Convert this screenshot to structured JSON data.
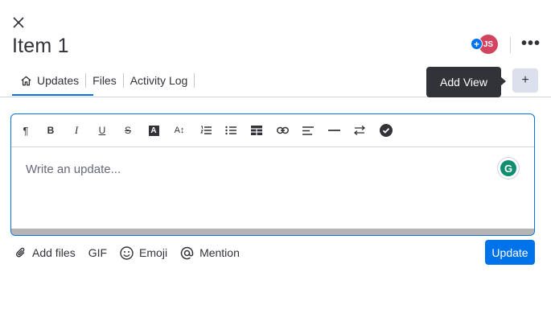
{
  "header": {
    "title": "Item 1",
    "avatar_initials": "JS",
    "add_badge_symbol": "+",
    "more_symbol": "•••"
  },
  "tabs": [
    {
      "label": "Updates",
      "icon": "home-icon",
      "active": true
    },
    {
      "label": "Files",
      "active": false
    },
    {
      "label": "Activity Log",
      "active": false
    }
  ],
  "tooltip": {
    "text": "Add View"
  },
  "add_view_button": {
    "symbol": "+"
  },
  "editor": {
    "placeholder": "Write an update...",
    "toolbar_icons": [
      "paragraph-icon",
      "bold-icon",
      "italic-icon",
      "underline-icon",
      "strikethrough-icon",
      "text-color-icon",
      "font-size-icon",
      "numbered-list-icon",
      "bullet-list-icon",
      "table-icon",
      "link-icon",
      "align-icon",
      "divider-icon",
      "direction-icon",
      "checklist-icon"
    ],
    "toolbar_glyphs": {
      "paragraph": "¶",
      "bold": "B",
      "italic": "I",
      "underline": "U",
      "strike": "S",
      "text_color": "A",
      "font_size": "A↕"
    },
    "grammarly_letter": "G"
  },
  "actions": [
    {
      "label": "Add files",
      "icon": "paperclip-icon"
    },
    {
      "label": "GIF"
    },
    {
      "label": "Emoji",
      "icon": "smiley-icon"
    },
    {
      "label": "Mention",
      "icon": "at-icon"
    }
  ],
  "update_button": {
    "label": "Update"
  },
  "colors": {
    "accent": "#0073ea",
    "avatar": "#d2445f",
    "text": "#323338",
    "tooltip_bg": "#323338"
  }
}
